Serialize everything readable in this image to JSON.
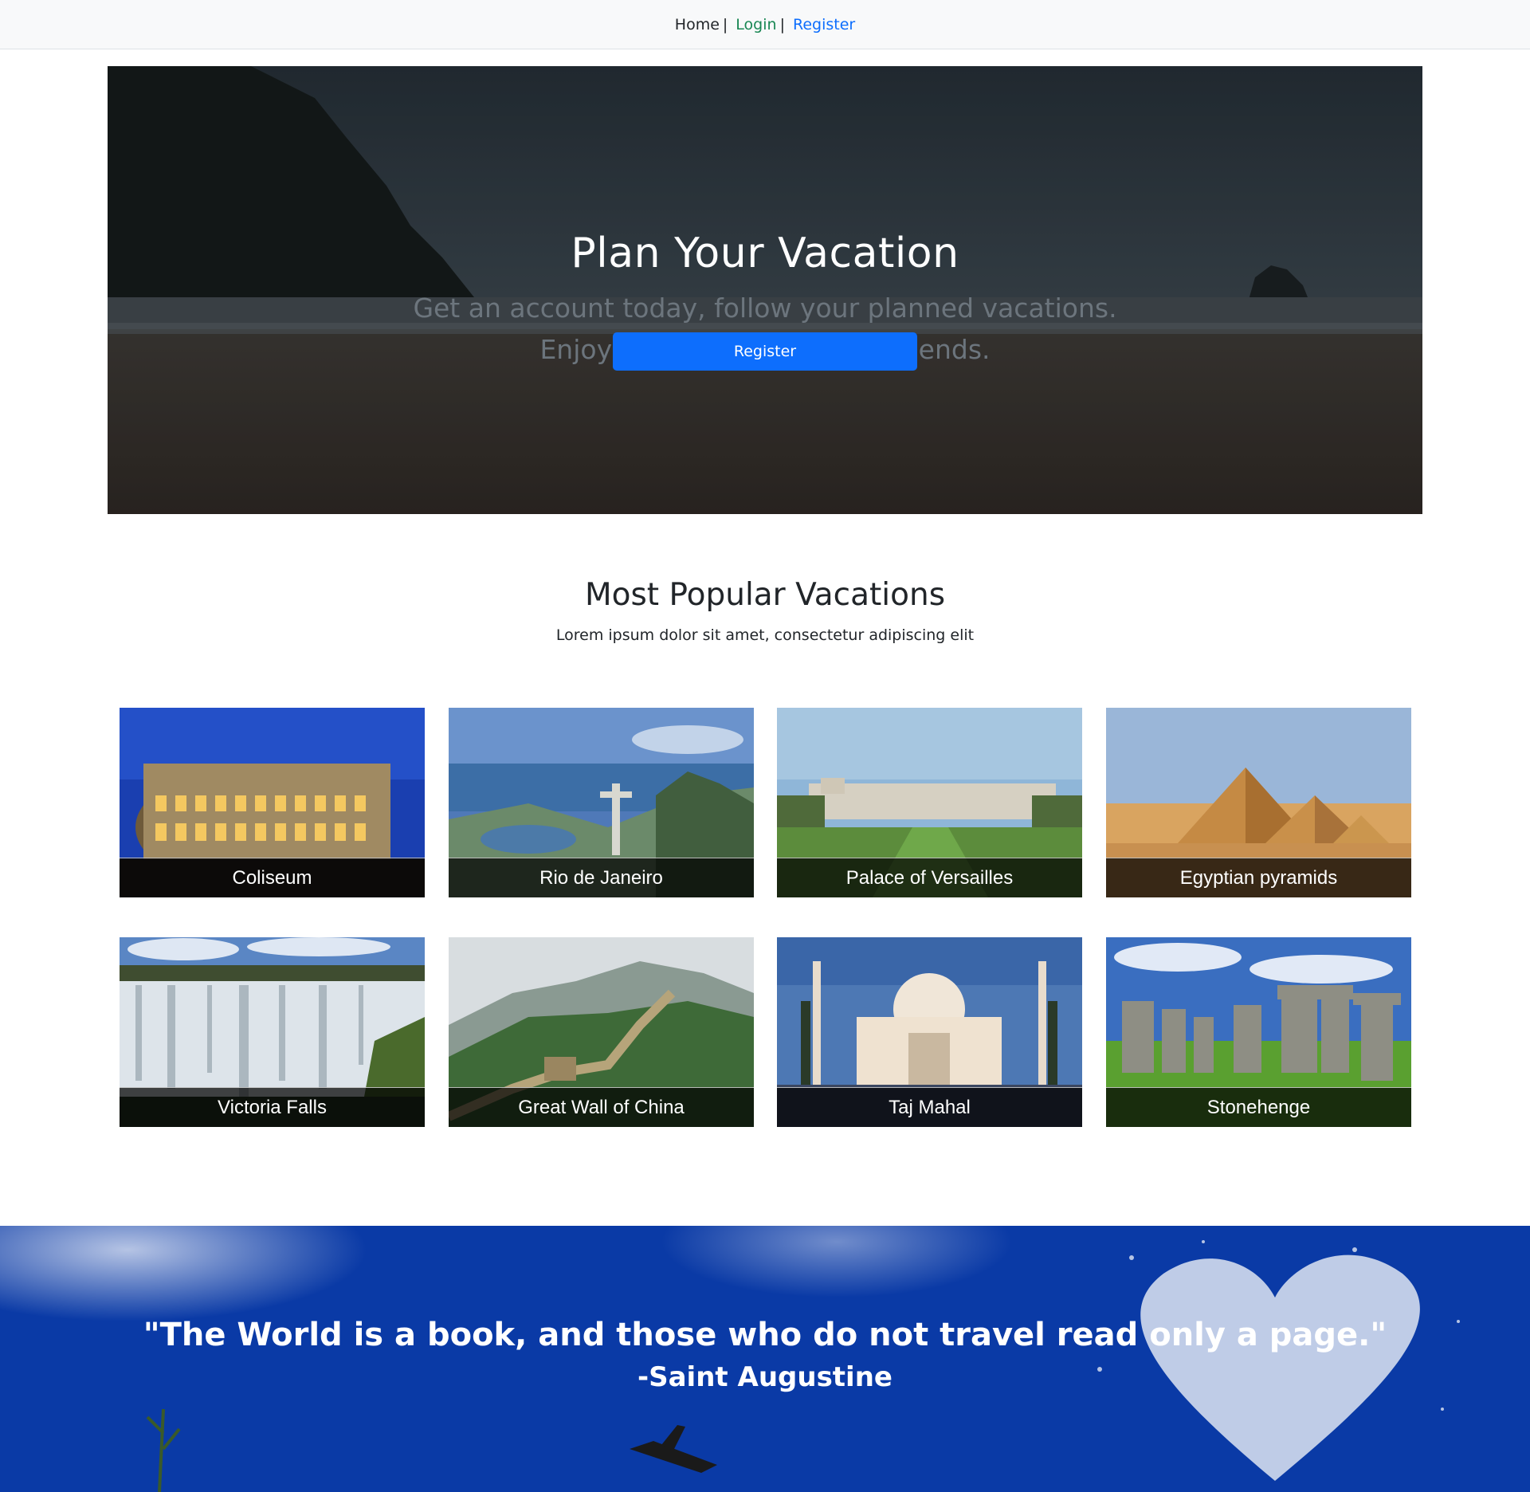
{
  "nav": {
    "home_label": "Home",
    "login_label": "Login",
    "register_label": "Register",
    "separator": "|"
  },
  "hero": {
    "title": "Plan Your Vacation",
    "subtitle_line1": "Get an account today, follow your planned vacations.",
    "subtitle_line2": "Enjoy and share with your friends.",
    "button_label": "Register"
  },
  "popular": {
    "title": "Most Popular Vacations",
    "subtitle": "Lorem ipsum dolor sit amet, consectetur adipiscing elit",
    "cards": [
      {
        "label": "Coliseum"
      },
      {
        "label": "Rio de Janeiro"
      },
      {
        "label": "Palace of Versailles"
      },
      {
        "label": "Egyptian pyramids"
      },
      {
        "label": "Victoria Falls"
      },
      {
        "label": "Great Wall of China"
      },
      {
        "label": "Taj Mahal"
      },
      {
        "label": "Stonehenge"
      }
    ]
  },
  "quote": {
    "text": "\"The World is a book, and those who do not travel read only a page.\"",
    "author": "-Saint Augustine"
  },
  "colors": {
    "primary": "#0d6efd",
    "login": "#198754",
    "navbar_bg": "#f8f9fa"
  }
}
